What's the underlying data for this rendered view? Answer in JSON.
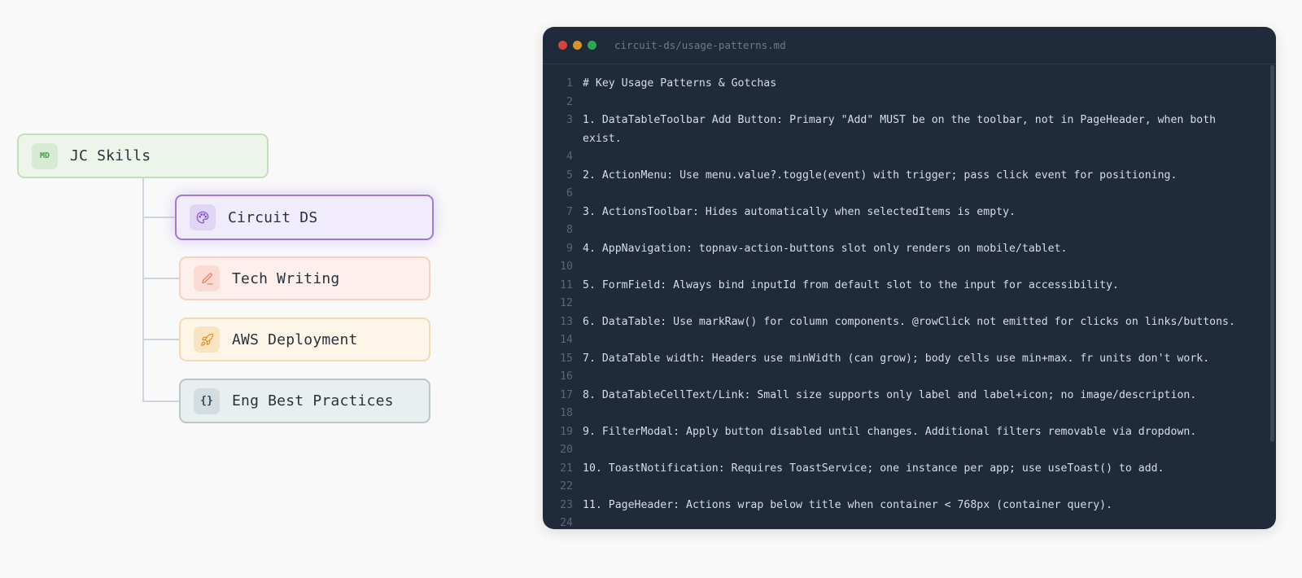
{
  "tree": {
    "root": {
      "badge": "MD",
      "label": "JC Skills"
    },
    "children": [
      {
        "label": "Circuit DS",
        "icon": "palette-icon"
      },
      {
        "label": "Tech Writing",
        "icon": "pencil-icon"
      },
      {
        "label": "AWS Deployment",
        "icon": "rocket-icon"
      },
      {
        "label": "Eng Best Practices",
        "icon": "braces-icon",
        "icon_text": "{}"
      }
    ]
  },
  "editor": {
    "filename": "circuit-ds/usage-patterns.md",
    "lines": [
      {
        "n": "1",
        "text": "# Key Usage Patterns & Gotchas"
      },
      {
        "n": "2",
        "text": ""
      },
      {
        "n": "3",
        "text": "1. DataTableToolbar Add Button: Primary \"Add\" MUST be on the toolbar, not in PageHeader, when both exist."
      },
      {
        "n": "4",
        "text": ""
      },
      {
        "n": "5",
        "text": "2. ActionMenu: Use menu.value?.toggle(event) with trigger; pass click event for positioning."
      },
      {
        "n": "6",
        "text": ""
      },
      {
        "n": "7",
        "text": "3. ActionsToolbar: Hides automatically when selectedItems is empty."
      },
      {
        "n": "8",
        "text": ""
      },
      {
        "n": "9",
        "text": "4. AppNavigation: topnav-action-buttons slot only renders on mobile/tablet."
      },
      {
        "n": "10",
        "text": ""
      },
      {
        "n": "11",
        "text": "5. FormField: Always bind inputId from default slot to the input for accessibility."
      },
      {
        "n": "12",
        "text": ""
      },
      {
        "n": "13",
        "text": "6. DataTable: Use markRaw() for column components. @rowClick not emitted for clicks on links/buttons."
      },
      {
        "n": "14",
        "text": ""
      },
      {
        "n": "15",
        "text": "7. DataTable width: Headers use minWidth (can grow); body cells use min+max. fr units don't work."
      },
      {
        "n": "16",
        "text": ""
      },
      {
        "n": "17",
        "text": "8. DataTableCellText/Link: Small size supports only label and label+icon; no image/description."
      },
      {
        "n": "18",
        "text": ""
      },
      {
        "n": "19",
        "text": "9. FilterModal: Apply button disabled until changes. Additional filters removable via dropdown."
      },
      {
        "n": "20",
        "text": ""
      },
      {
        "n": "21",
        "text": "10. ToastNotification: Requires ToastService; one instance per app; use useToast() to add."
      },
      {
        "n": "22",
        "text": ""
      },
      {
        "n": "23",
        "text": "11. PageHeader: Actions wrap below title when container < 768px (container query)."
      },
      {
        "n": "24",
        "text": ""
      }
    ]
  }
}
